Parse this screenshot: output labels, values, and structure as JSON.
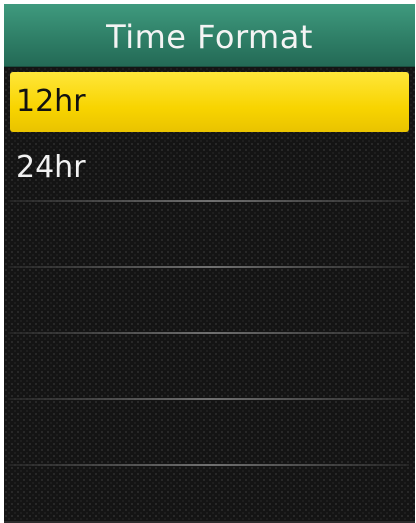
{
  "screen": {
    "title": "Time Format"
  },
  "options": [
    {
      "label": "12hr",
      "selected": true
    },
    {
      "label": "24hr",
      "selected": false
    }
  ],
  "colors": {
    "title_bar": "#2f7f67",
    "selection": "#f8d400",
    "background": "#141414",
    "text": "#f2f2f2"
  }
}
